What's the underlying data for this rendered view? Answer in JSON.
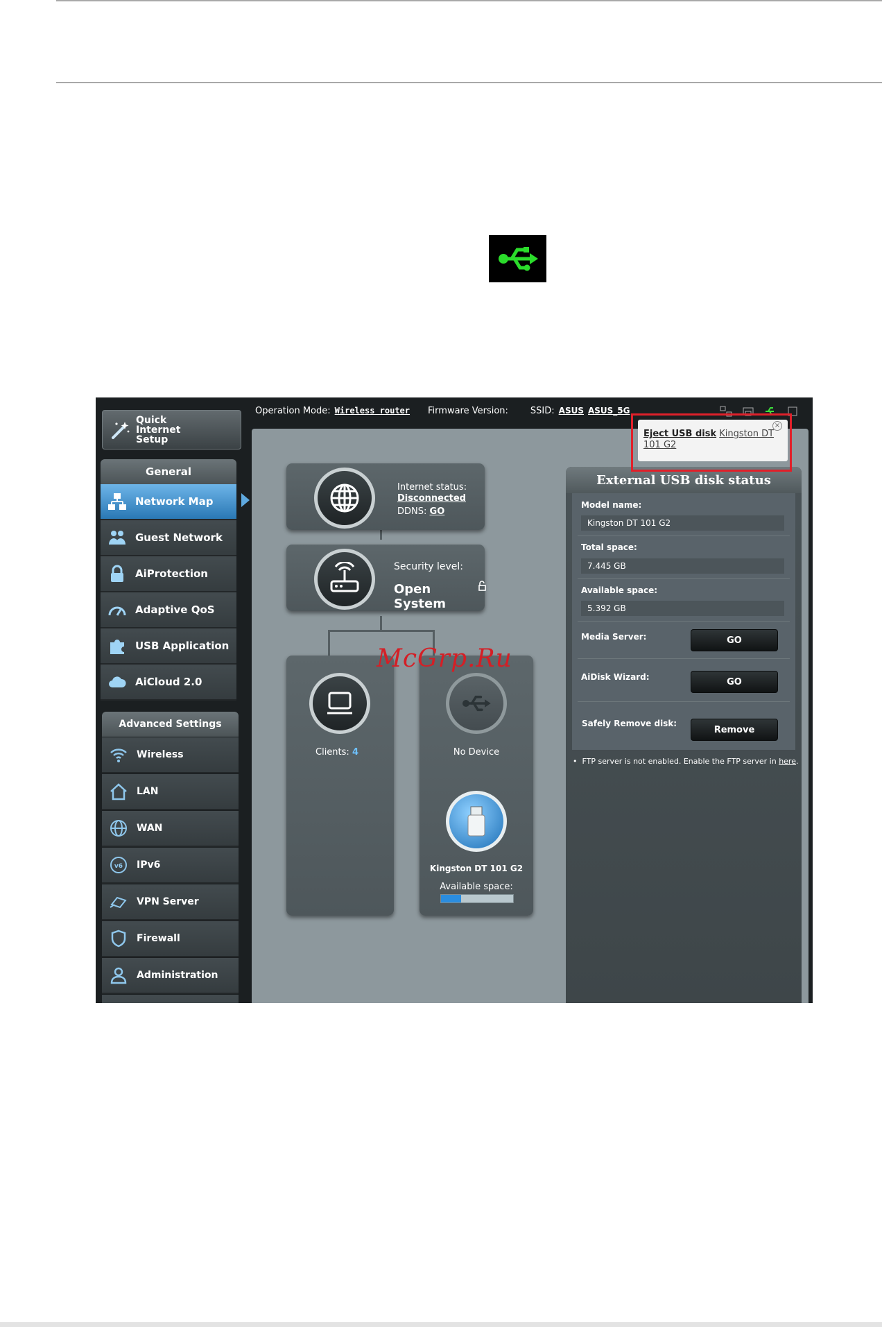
{
  "usb_badge_icon": "usb-icon",
  "screenshot": {
    "sidebar": {
      "quick_setup": {
        "label": "Quick Internet Setup",
        "icon": "magic-wand-icon"
      },
      "general": {
        "header": "General",
        "items": [
          {
            "label": "Network Map",
            "icon": "network-map-icon",
            "active": true
          },
          {
            "label": "Guest Network",
            "icon": "guest-network-icon"
          },
          {
            "label": "AiProtection",
            "icon": "lock-icon"
          },
          {
            "label": "Adaptive QoS",
            "icon": "gauge-icon"
          },
          {
            "label": "USB Application",
            "icon": "puzzle-icon"
          },
          {
            "label": "AiCloud 2.0",
            "icon": "cloud-icon"
          }
        ]
      },
      "advanced": {
        "header": "Advanced Settings",
        "items": [
          {
            "label": "Wireless",
            "icon": "wifi-icon"
          },
          {
            "label": "LAN",
            "icon": "home-icon"
          },
          {
            "label": "WAN",
            "icon": "globe-icon"
          },
          {
            "label": "IPv6",
            "icon": "ipv6-icon"
          },
          {
            "label": "VPN Server",
            "icon": "vpn-icon"
          },
          {
            "label": "Firewall",
            "icon": "shield-icon"
          },
          {
            "label": "Administration",
            "icon": "user-icon"
          }
        ]
      }
    },
    "topbar": {
      "op_mode_label": "Operation Mode:",
      "op_mode_value": "Wireless router",
      "firmware_label": "Firmware Version:",
      "ssid_label": "SSID:",
      "ssid_1": "ASUS",
      "ssid_2": "ASUS_5G"
    },
    "internet_card": {
      "status_label": "Internet status:",
      "status_value": "Disconnected",
      "ddns_label": "DDNS:",
      "ddns_link": "GO"
    },
    "security_card": {
      "label": "Security level:",
      "value": "Open System"
    },
    "clients_card": {
      "label": "Clients:",
      "count": "4"
    },
    "usb_card": {
      "no_device": "No Device",
      "disk_name": "Kingston DT 101 G2",
      "available_label": "Available space:",
      "available_fraction": 0.28
    },
    "disk_panel": {
      "title": "External USB disk status",
      "model_label": "Model name:",
      "model_value": "Kingston DT 101 G2",
      "total_label": "Total space:",
      "total_value": "7.445 GB",
      "available_label": "Available space:",
      "available_value": "5.392 GB",
      "media_label": "Media Server:",
      "media_btn": "GO",
      "aidisk_label": "AiDisk Wizard:",
      "aidisk_btn": "GO",
      "remove_label": "Safely Remove disk:",
      "remove_btn": "Remove",
      "note_prefix": "FTP server is not enabled. Enable the FTP server in ",
      "note_link": "here",
      "note_suffix": "."
    },
    "popup": {
      "eject_link": "Eject USB disk",
      "eject_device": "Kingston DT 101 G2"
    },
    "watermark": "McGrp.Ru"
  }
}
